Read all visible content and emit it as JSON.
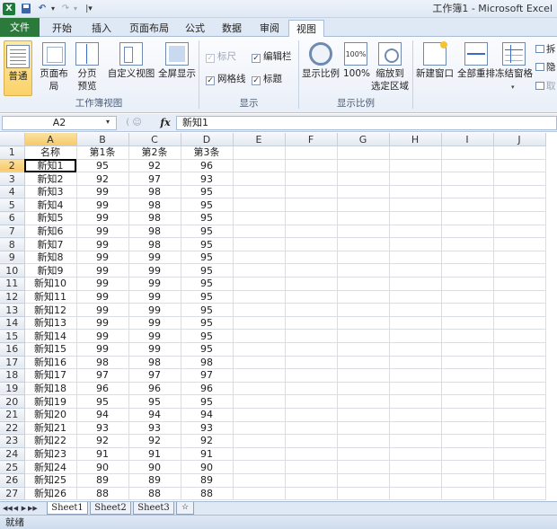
{
  "title_bar": {
    "app_icon_letter": "X",
    "undo_glyph": "↶",
    "redo_glyph": "↷",
    "dropdown_glyph": "▾",
    "customize_glyph": "|▾",
    "title": "工作簿1 - Microsoft Excel"
  },
  "ribbon_tabs": {
    "file": "文件",
    "home": "开始",
    "insert": "插入",
    "page_layout": "页面布局",
    "formulas": "公式",
    "data": "数据",
    "review": "审阅",
    "view": "视图",
    "active": "视图"
  },
  "ribbon": {
    "workbook_views": {
      "group_label": "工作簿视图",
      "normal": "普通",
      "page_layout": "页面布局",
      "page_break_line1": "分页",
      "page_break_line2": "预览",
      "custom_views": "自定义视图",
      "full_screen": "全屏显示"
    },
    "show": {
      "group_label": "显示",
      "ruler": "标尺",
      "gridlines": "网格线",
      "formula_bar": "编辑栏",
      "headings": "标题",
      "check_glyph": "✓"
    },
    "zoom": {
      "group_label": "显示比例",
      "zoom": "显示比例",
      "hundred": "100%",
      "zoom_to_selection_line1": "缩放到",
      "zoom_to_selection_line2": "选定区域"
    },
    "window": {
      "new_window": "新建窗口",
      "arrange_all": "全部重排",
      "freeze_panes": "冻结窗格",
      "split": "拆",
      "hide": "隐",
      "unhide": "取",
      "dropdown_glyph": "▾"
    }
  },
  "formula_bar": {
    "name_box": "A2",
    "name_box_drop": "▾",
    "cancel_glyph": "(  ☺",
    "fx": "fx",
    "content": "新知1"
  },
  "sheet": {
    "columns": [
      "A",
      "B",
      "C",
      "D",
      "E",
      "F",
      "G",
      "H",
      "I",
      "J"
    ],
    "selected_column": "A",
    "selected_row": "2",
    "active_cell": "A2",
    "rows": [
      {
        "n": "1",
        "cells": [
          "名称",
          "第1条",
          "第2条",
          "第3条"
        ]
      },
      {
        "n": "2",
        "cells": [
          "新知1",
          "95",
          "92",
          "96"
        ]
      },
      {
        "n": "3",
        "cells": [
          "新知2",
          "92",
          "97",
          "93"
        ]
      },
      {
        "n": "4",
        "cells": [
          "新知3",
          "99",
          "98",
          "95"
        ]
      },
      {
        "n": "5",
        "cells": [
          "新知4",
          "99",
          "98",
          "95"
        ]
      },
      {
        "n": "6",
        "cells": [
          "新知5",
          "99",
          "98",
          "95"
        ]
      },
      {
        "n": "7",
        "cells": [
          "新知6",
          "99",
          "98",
          "95"
        ]
      },
      {
        "n": "8",
        "cells": [
          "新知7",
          "99",
          "98",
          "95"
        ]
      },
      {
        "n": "9",
        "cells": [
          "新知8",
          "99",
          "99",
          "95"
        ]
      },
      {
        "n": "10",
        "cells": [
          "新知9",
          "99",
          "99",
          "95"
        ]
      },
      {
        "n": "11",
        "cells": [
          "新知10",
          "99",
          "99",
          "95"
        ]
      },
      {
        "n": "12",
        "cells": [
          "新知11",
          "99",
          "99",
          "95"
        ]
      },
      {
        "n": "13",
        "cells": [
          "新知12",
          "99",
          "99",
          "95"
        ]
      },
      {
        "n": "14",
        "cells": [
          "新知13",
          "99",
          "99",
          "95"
        ]
      },
      {
        "n": "15",
        "cells": [
          "新知14",
          "99",
          "99",
          "95"
        ]
      },
      {
        "n": "16",
        "cells": [
          "新知15",
          "99",
          "99",
          "95"
        ]
      },
      {
        "n": "17",
        "cells": [
          "新知16",
          "98",
          "98",
          "98"
        ]
      },
      {
        "n": "18",
        "cells": [
          "新知17",
          "97",
          "97",
          "97"
        ]
      },
      {
        "n": "19",
        "cells": [
          "新知18",
          "96",
          "96",
          "96"
        ]
      },
      {
        "n": "20",
        "cells": [
          "新知19",
          "95",
          "95",
          "95"
        ]
      },
      {
        "n": "21",
        "cells": [
          "新知20",
          "94",
          "94",
          "94"
        ]
      },
      {
        "n": "22",
        "cells": [
          "新知21",
          "93",
          "93",
          "93"
        ]
      },
      {
        "n": "23",
        "cells": [
          "新知22",
          "92",
          "92",
          "92"
        ]
      },
      {
        "n": "24",
        "cells": [
          "新知23",
          "91",
          "91",
          "91"
        ]
      },
      {
        "n": "25",
        "cells": [
          "新知24",
          "90",
          "90",
          "90"
        ]
      },
      {
        "n": "26",
        "cells": [
          "新知25",
          "89",
          "89",
          "89"
        ]
      },
      {
        "n": "27",
        "cells": [
          "新知26",
          "88",
          "88",
          "88"
        ]
      }
    ]
  },
  "sheet_tabs": {
    "nav_first": "◀◀",
    "nav_prev": "◀",
    "nav_next": "▶",
    "nav_last": "▶▶",
    "sheet1": "Sheet1",
    "sheet2": "Sheet2",
    "sheet3": "Sheet3",
    "new_sheet_glyph": "☆"
  },
  "status_bar": {
    "status": "就绪"
  }
}
